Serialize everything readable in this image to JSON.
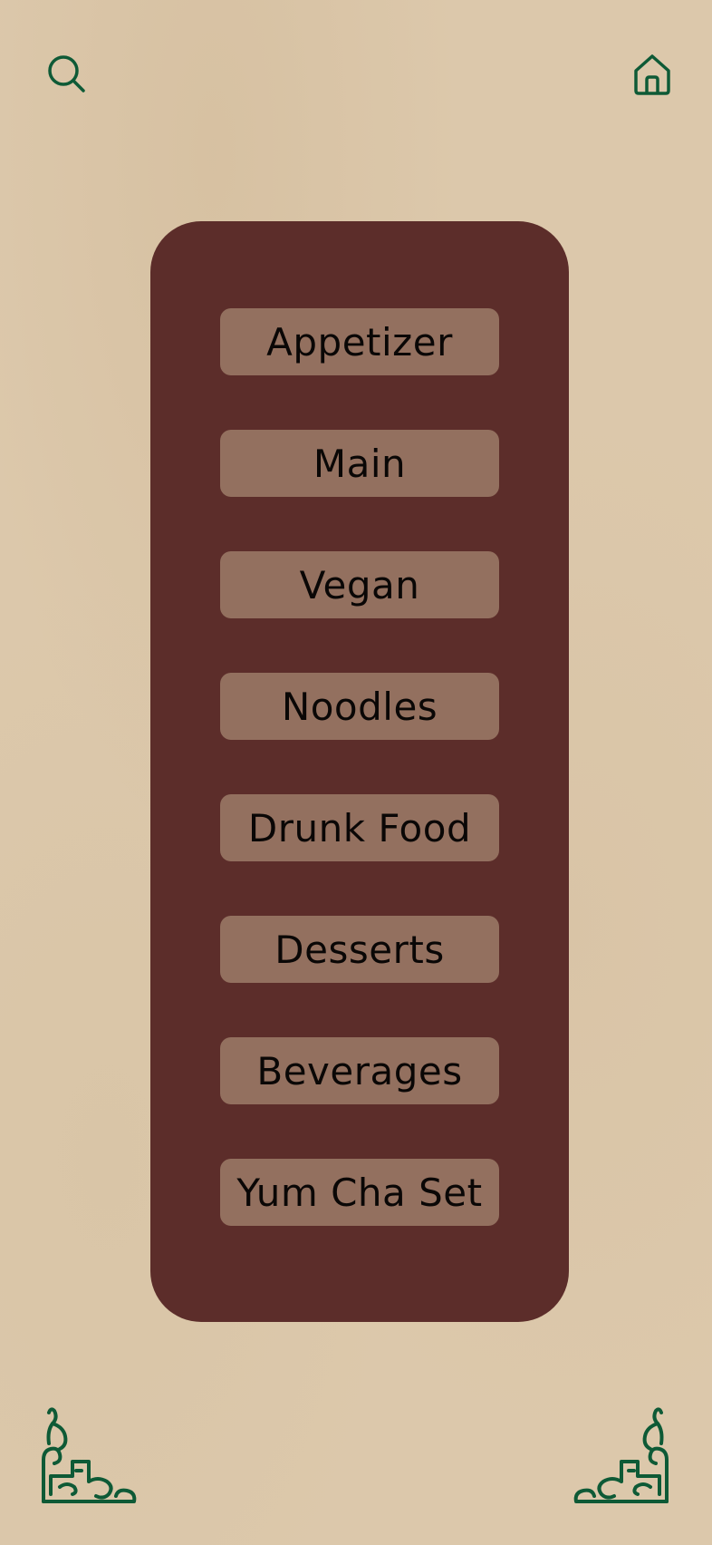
{
  "header": {
    "search_icon": "search-icon",
    "home_icon": "home-icon"
  },
  "menu": {
    "items": [
      {
        "label": "Appetizer"
      },
      {
        "label": "Main"
      },
      {
        "label": "Vegan"
      },
      {
        "label": "Noodles"
      },
      {
        "label": "Drunk Food"
      },
      {
        "label": "Desserts"
      },
      {
        "label": "Beverages"
      },
      {
        "label": "Yum Cha Set"
      }
    ]
  },
  "decorations": {
    "left_corner_icon": "ornament-corner-left-icon",
    "right_corner_icon": "ornament-corner-right-icon"
  },
  "colors": {
    "background": "#dcc8ab",
    "panel": "#5c2d2a",
    "button": "#93705f",
    "accent_green": "#0e5a36",
    "text": "#0a0706"
  }
}
